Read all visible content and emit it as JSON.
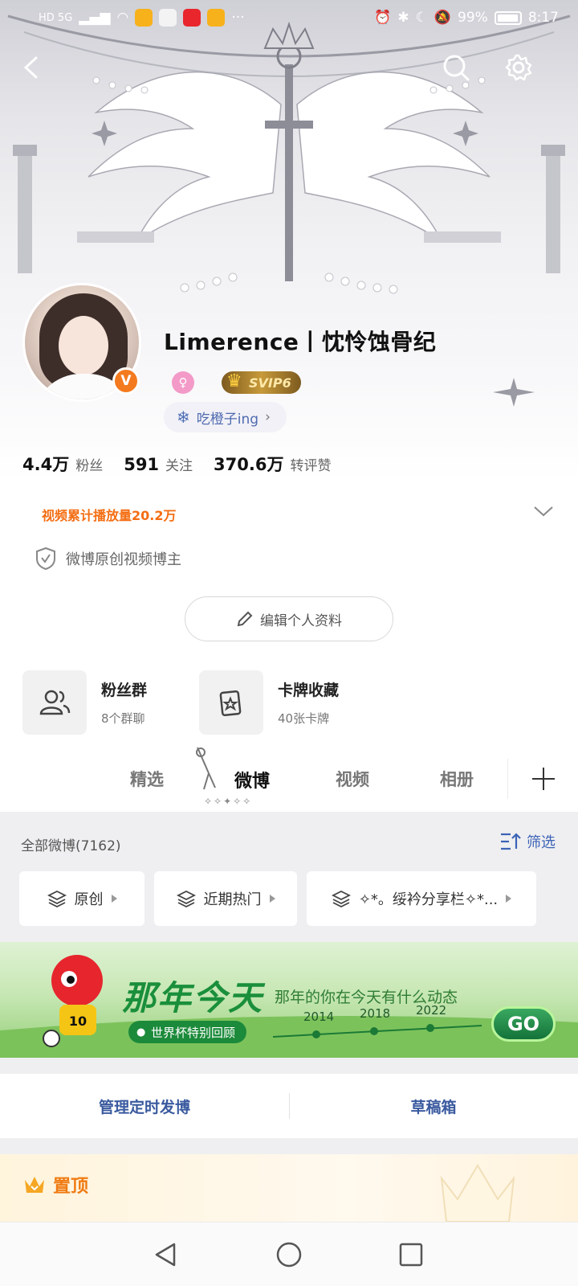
{
  "status_bar": {
    "network": "HD 5G",
    "battery": "99%",
    "time": "8:17"
  },
  "profile": {
    "username": "Limerence丨忱怜蚀骨纪",
    "svip_label": "SVIP6",
    "verified_badge": "V",
    "status_text": "吃橙子ing",
    "stats": [
      {
        "value": "4.4万",
        "label": "粉丝"
      },
      {
        "value": "591",
        "label": "关注"
      },
      {
        "value": "370.6万",
        "label": "转评赞"
      }
    ],
    "video_plays": "视频累计播放量20.2万",
    "certification": "微博原创视频博主",
    "edit_button": "编辑个人资料"
  },
  "quick_entries": [
    {
      "title": "粉丝群",
      "subtitle": "8个群聊",
      "icon": "users-icon"
    },
    {
      "title": "卡牌收藏",
      "subtitle": "40张卡牌",
      "icon": "card-star-icon"
    }
  ],
  "tabs": [
    {
      "label": "精选",
      "active": false
    },
    {
      "label": "微博",
      "active": true
    },
    {
      "label": "视频",
      "active": false
    },
    {
      "label": "相册",
      "active": false
    }
  ],
  "feed": {
    "title": "全部微博(7162)",
    "filter_label": "筛选",
    "chips": [
      {
        "label": "原创"
      },
      {
        "label": "近期热门"
      },
      {
        "label": "✧*。绥衿分享栏✧*..."
      }
    ]
  },
  "banner": {
    "title": "那年今天",
    "subtitle": "那年的你在今天有什么动态",
    "tag": "世界杯特别回顾",
    "years": [
      "2014",
      "2018",
      "2022"
    ],
    "go_label": "GO",
    "mascot_number": "10"
  },
  "manage": {
    "scheduled": "管理定时发博",
    "drafts": "草稿箱"
  },
  "pinned": {
    "label": "置顶"
  },
  "colors": {
    "accent_orange": "#f46d12",
    "link_blue": "#3c63b6",
    "verified_orange": "#f47a1f",
    "banner_green": "#1a8f3b"
  }
}
